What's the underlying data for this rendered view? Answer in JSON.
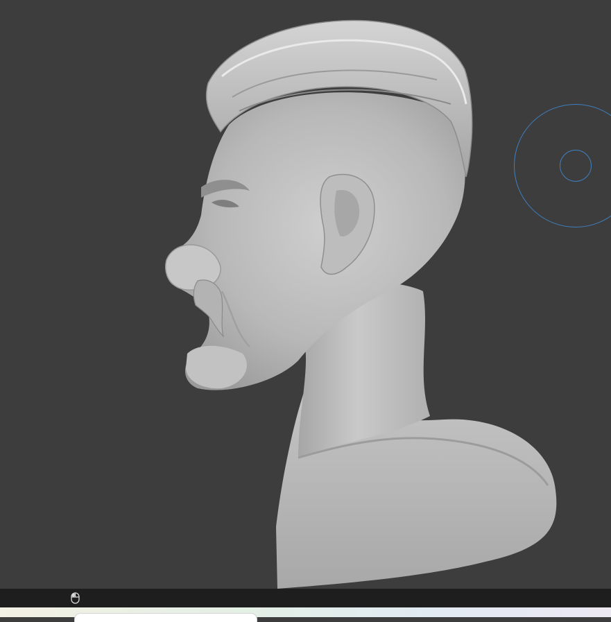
{
  "viewport": {
    "mode": "sculpt",
    "subject": "bust-model",
    "background_color": "#3d3d3d",
    "brush_cursor_color": "#3f7fbf"
  },
  "status_bar": {
    "icons": [
      "mouse-icon"
    ],
    "background_color": "#1e1e1e"
  },
  "taskbar": {
    "icons": []
  }
}
